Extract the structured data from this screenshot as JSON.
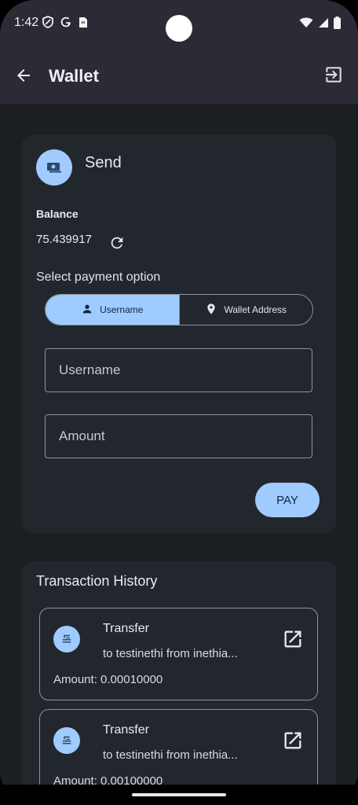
{
  "status_bar": {
    "time": "1:42",
    "left_icons": [
      "shield-icon",
      "google-icon",
      "sim-card-icon"
    ],
    "right_icons": [
      "wifi-icon",
      "signal-icon",
      "battery-icon"
    ]
  },
  "app_bar": {
    "title": "Wallet",
    "back_icon": "arrow-back-icon",
    "logout_icon": "logout-icon"
  },
  "send_card": {
    "title": "Send",
    "icon": "payments-icon",
    "balance_label": "Balance",
    "balance_value": "75.439917",
    "refresh_icon": "refresh-icon",
    "payment_option_label": "Select payment option",
    "payment_options": [
      {
        "label": "Username",
        "icon": "person-icon",
        "selected": true
      },
      {
        "label": "Wallet Address",
        "icon": "location-pin-icon",
        "selected": false
      }
    ],
    "username_placeholder": "Username",
    "amount_placeholder": "Amount",
    "pay_label": "PAY"
  },
  "history": {
    "title": "Transaction History",
    "transactions": [
      {
        "type": "Transfer",
        "description": "to testinethi from inethia...",
        "amount": "Amount: 0.00010000",
        "icon": "bank-transfer-icon",
        "open_icon": "open-in-new-icon"
      },
      {
        "type": "Transfer",
        "description": "to testinethi from inethia...",
        "amount": "Amount: 0.00100000",
        "icon": "bank-transfer-icon",
        "open_icon": "open-in-new-icon"
      }
    ]
  },
  "colors": {
    "accent": "#9fcbff",
    "background": "#1c1f22",
    "card": "#22272d",
    "app_bar": "#2c2a35"
  }
}
